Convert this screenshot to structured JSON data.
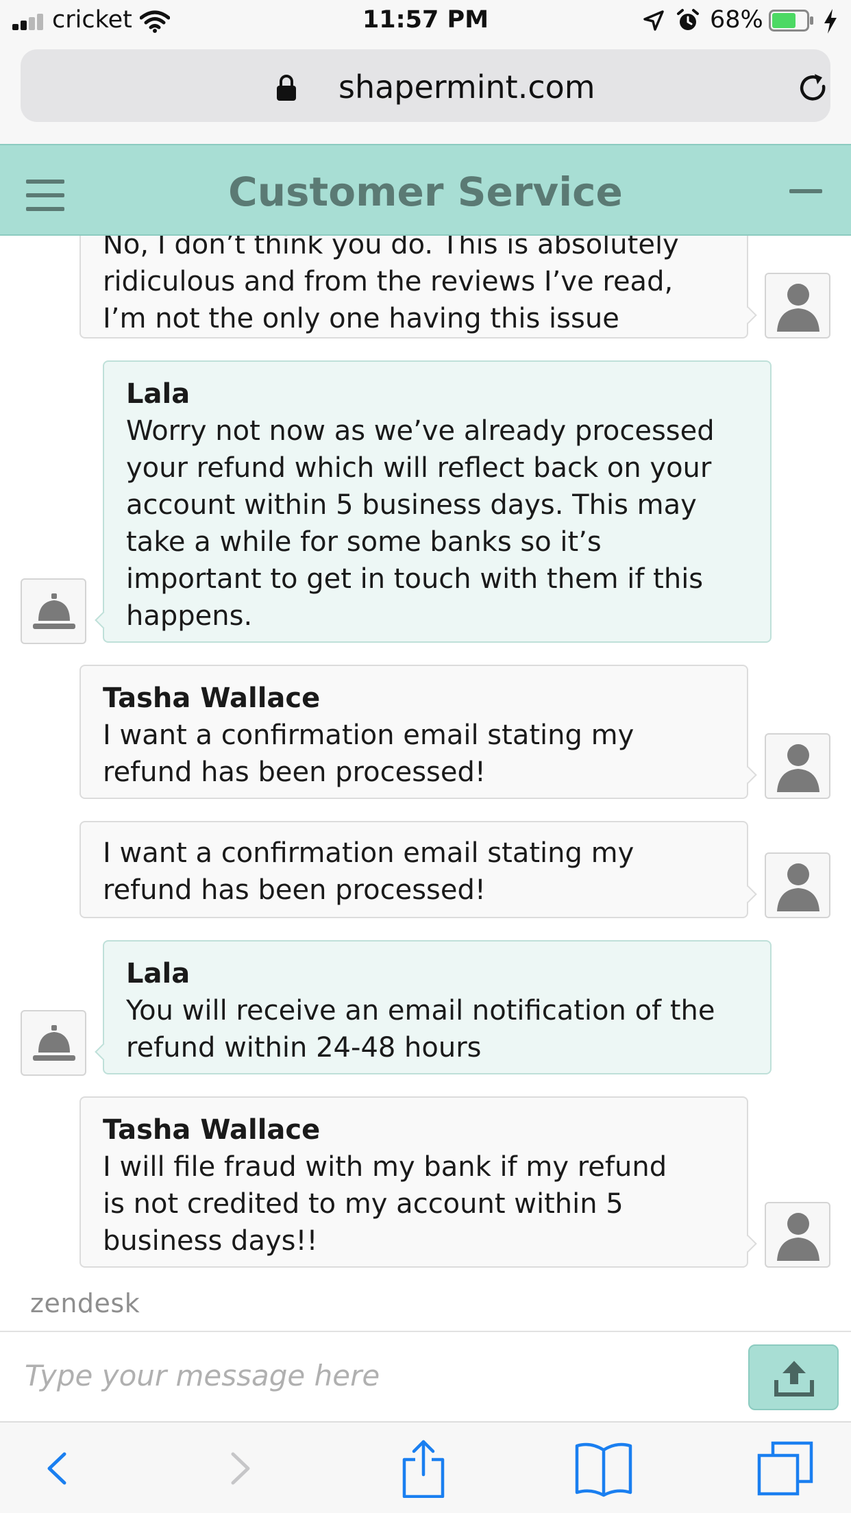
{
  "status_bar": {
    "carrier": "cricket",
    "time": "11:57 PM",
    "battery_percent": "68%",
    "battery_level": 0.68,
    "battery_color": "#4cd964"
  },
  "browser": {
    "url": "shapermint.com"
  },
  "widget": {
    "title": "Customer Service",
    "header_color": "#a8ded4",
    "title_color": "#5b7a74"
  },
  "messages": [
    {
      "sender": "user",
      "name": "",
      "text": "No, I don’t think you do. This is absolutely\nridiculous and from the reviews I’ve read,\nI’m not the only one having this issue"
    },
    {
      "sender": "agent",
      "name": "Lala",
      "text": "Worry not now as we’ve already processed\nyour refund which will reflect back on your\naccount within 5 business days. This may\ntake a while for some banks so it’s\nimportant to get in touch with them if this\nhappens."
    },
    {
      "sender": "user",
      "name": "Tasha Wallace",
      "text": "I want a confirmation email stating my\nrefund has been processed!"
    },
    {
      "sender": "user",
      "name": "",
      "text": "I want a confirmation email stating my\nrefund has been processed!"
    },
    {
      "sender": "agent",
      "name": "Lala",
      "text": "You will receive an email notification of the\nrefund within 24-48 hours"
    },
    {
      "sender": "user",
      "name": "Tasha Wallace",
      "text": "I will file fraud with my bank if my refund\nis not credited to my account within 5\nbusiness days!!"
    }
  ],
  "branding": {
    "logo_text": "zendesk"
  },
  "composer": {
    "placeholder": "Type your message here"
  },
  "icons": {
    "user_avatar": "person-silhouette-icon",
    "agent_avatar": "service-bell-icon",
    "send": "upload-arrow-icon",
    "toolbar": [
      "back-arrow-icon",
      "forward-arrow-icon",
      "share-icon",
      "bookmarks-book-icon",
      "tabs-icon"
    ]
  }
}
